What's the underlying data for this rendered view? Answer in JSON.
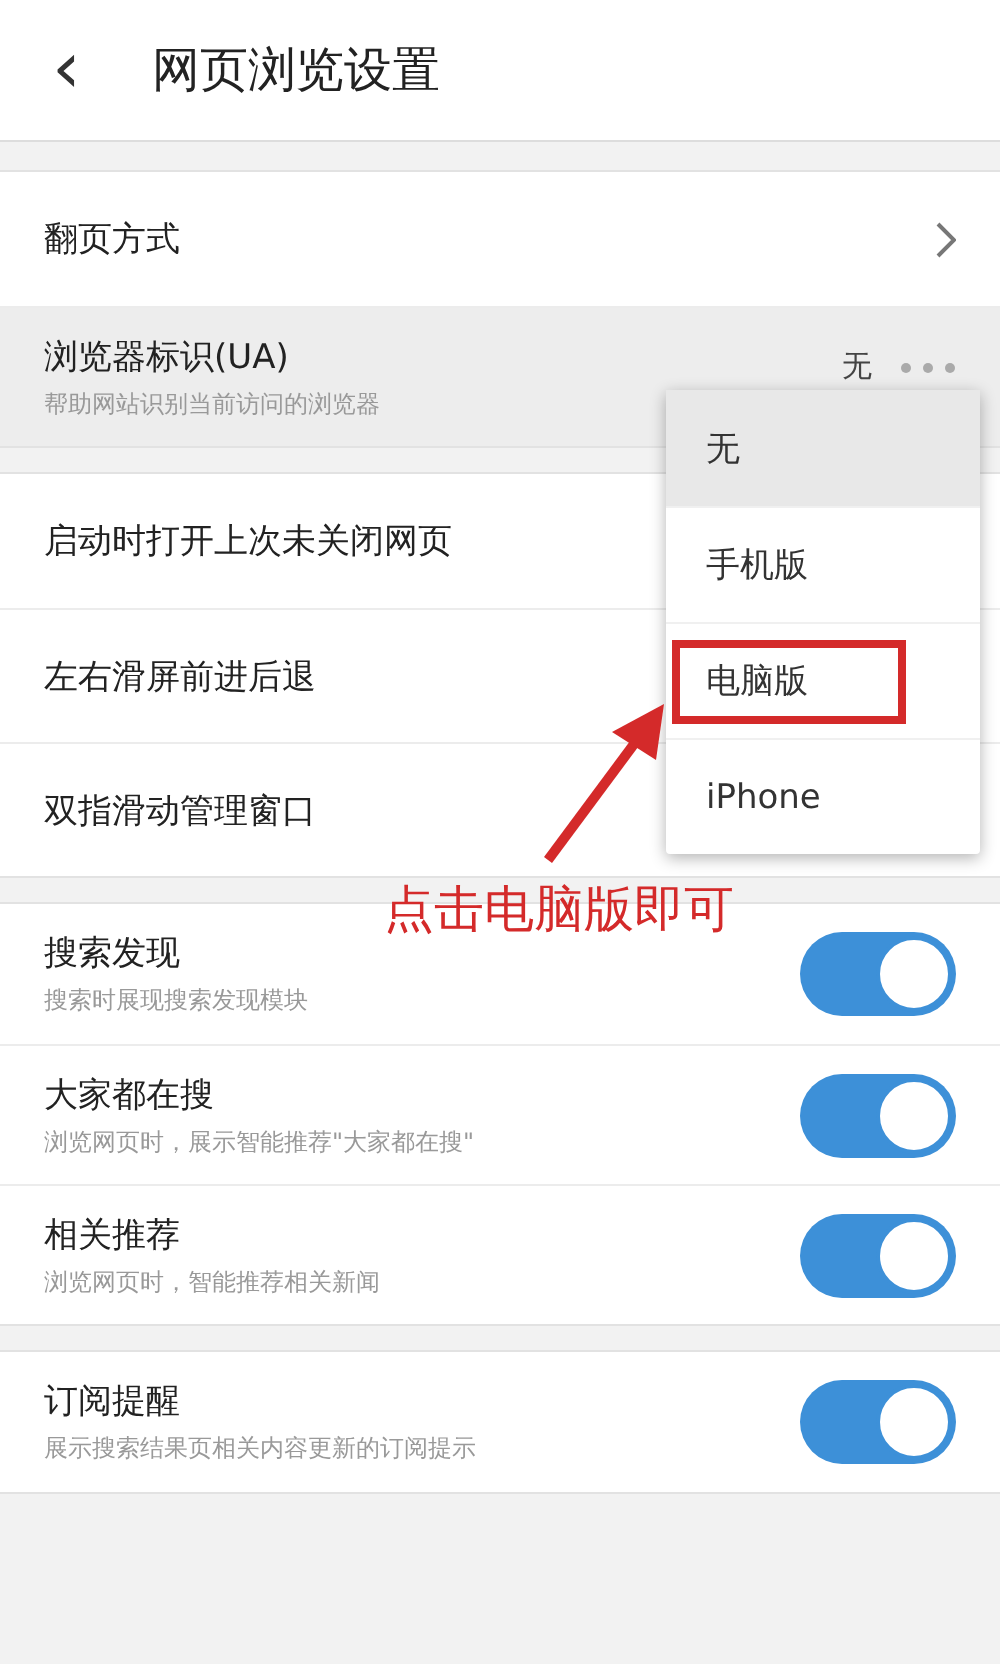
{
  "header": {
    "back": "‹",
    "title": "网页浏览设置"
  },
  "groups": [
    {
      "items": [
        {
          "kind": "link",
          "label": "翻页方式"
        },
        {
          "kind": "value",
          "label": "浏览器标识(UA)",
          "subtitle": "帮助网站识别当前访问的浏览器",
          "value": "无"
        }
      ]
    },
    {
      "items": [
        {
          "kind": "plain",
          "label": "启动时打开上次未关闭网页"
        },
        {
          "kind": "plain",
          "label": "左右滑屏前进后退"
        },
        {
          "kind": "plain",
          "label": "双指滑动管理窗口"
        }
      ]
    },
    {
      "items": [
        {
          "kind": "toggle",
          "label": "搜索发现",
          "subtitle": "搜索时展现搜索发现模块",
          "on": true
        },
        {
          "kind": "toggle",
          "label": "大家都在搜",
          "subtitle": "浏览网页时，展示智能推荐\"大家都在搜\"",
          "on": true
        },
        {
          "kind": "toggle",
          "label": "相关推荐",
          "subtitle": "浏览网页时，智能推荐相关新闻",
          "on": true
        }
      ]
    },
    {
      "items": [
        {
          "kind": "toggle",
          "label": "订阅提醒",
          "subtitle": "展示搜索结果页相关内容更新的订阅提示",
          "on": true
        }
      ]
    }
  ],
  "dropdown": {
    "options": [
      {
        "label": "无",
        "selected": true,
        "annotated": false
      },
      {
        "label": "手机版",
        "selected": false,
        "annotated": false
      },
      {
        "label": "电脑版",
        "selected": false,
        "annotated": true
      },
      {
        "label": "iPhone",
        "selected": false,
        "annotated": false
      }
    ]
  },
  "annotation": {
    "text": "点击电脑版即可"
  }
}
